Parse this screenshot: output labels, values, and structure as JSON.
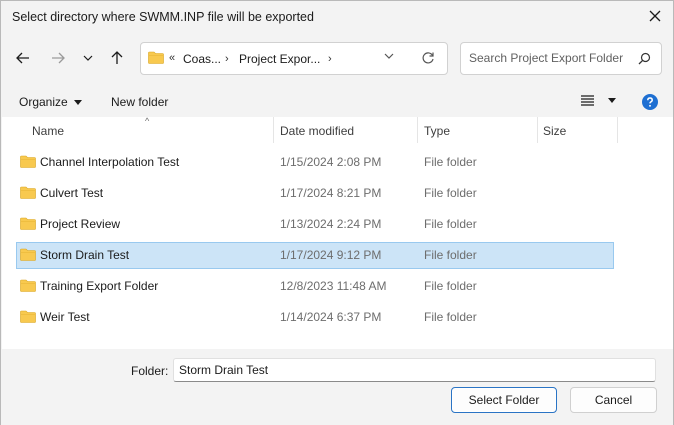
{
  "window": {
    "title": "Select directory where SWMM.INP file will be exported"
  },
  "nav": {
    "breadcrumb_overflow": "«",
    "breadcrumbs": [
      "Coas...",
      "Project Expor..."
    ],
    "search_placeholder": "Search Project Export Folder"
  },
  "toolbar": {
    "organize_label": "Organize",
    "new_folder_label": "New folder"
  },
  "columns": {
    "name": "Name",
    "date_modified": "Date modified",
    "type": "Type",
    "size": "Size"
  },
  "files": [
    {
      "name": "Channel Interpolation Test",
      "date": "1/15/2024 2:08 PM",
      "type": "File folder"
    },
    {
      "name": "Culvert Test",
      "date": "1/17/2024 8:21 PM",
      "type": "File folder"
    },
    {
      "name": "Project Review",
      "date": "1/13/2024 2:24 PM",
      "type": "File folder"
    },
    {
      "name": "Storm Drain Test",
      "date": "1/17/2024 9:12 PM",
      "type": "File folder"
    },
    {
      "name": "Training Export Folder",
      "date": "12/8/2023 11:48 AM",
      "type": "File folder"
    },
    {
      "name": "Weir Test",
      "date": "1/14/2024 6:37 PM",
      "type": "File folder"
    }
  ],
  "selected_file": "Storm Drain Test",
  "footer": {
    "folder_label": "Folder:",
    "folder_value": "Storm Drain Test",
    "select_label": "Select Folder",
    "cancel_label": "Cancel"
  },
  "colors": {
    "accent": "#0067c0",
    "folder": "#f8c94f",
    "selection": "#cce4f7"
  }
}
